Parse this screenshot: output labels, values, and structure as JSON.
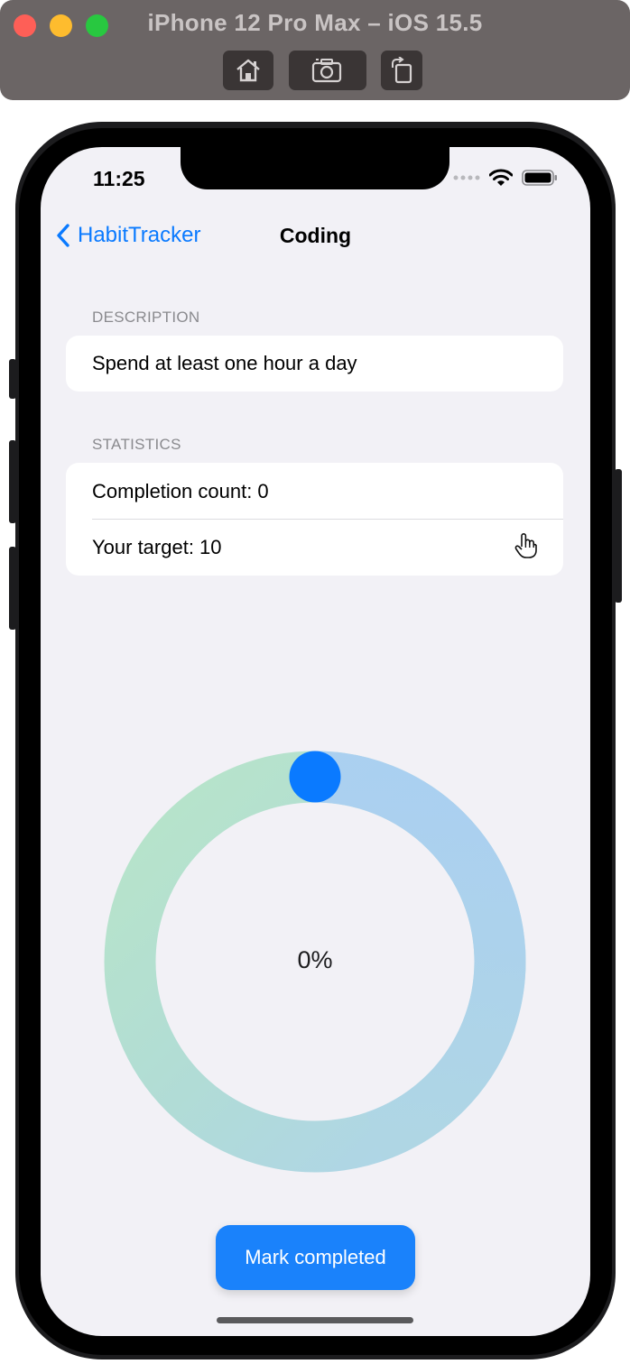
{
  "simulator": {
    "title": "iPhone 12 Pro Max – iOS 15.5",
    "buttons": [
      "home-icon",
      "screenshot-icon",
      "rotate-icon"
    ]
  },
  "status_bar": {
    "time": "11:25"
  },
  "nav": {
    "back_label": "HabitTracker",
    "title": "Coding"
  },
  "description": {
    "header": "DESCRIPTION",
    "text": "Spend at least one hour a day"
  },
  "statistics": {
    "header": "STATISTICS",
    "completion": "Completion count: 0",
    "target": "Your target: 10"
  },
  "progress": {
    "label": "0%",
    "value": 0
  },
  "action": {
    "label": "Mark completed"
  },
  "colors": {
    "accent": "#0a7aff",
    "button": "#1a82fb",
    "ring_green": "#b6e3cb",
    "ring_blue": "#abd0f5",
    "ring_teal": "#b0d9dc",
    "knob": "#0a7aff",
    "background": "#f2f1f6"
  }
}
